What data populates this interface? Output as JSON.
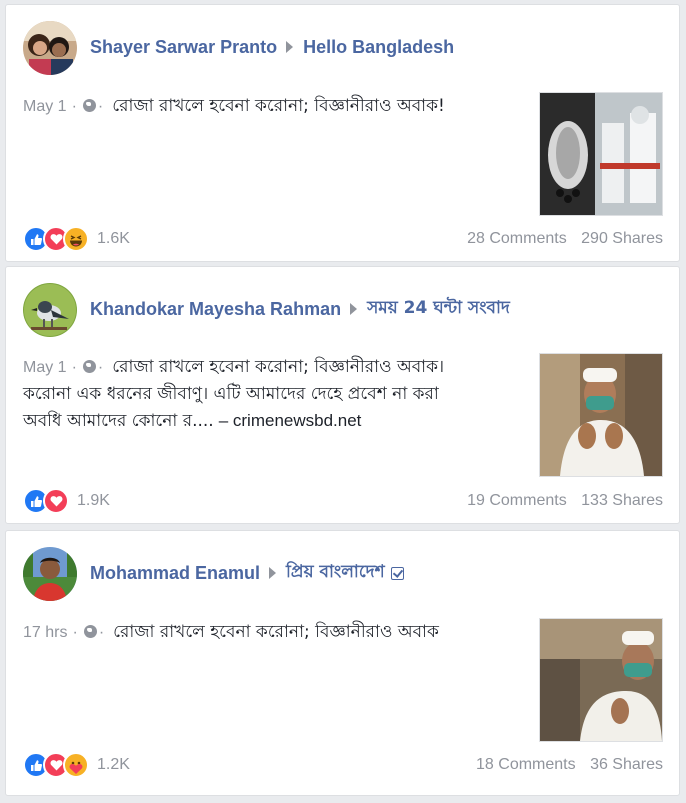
{
  "posts": [
    {
      "author": "Shayer Sarwar Pranto",
      "group": "Hello Bangladesh",
      "verified": false,
      "time": "May 1",
      "text_lines": [
        "রোজা রাখলে হবেনা করোনা; বিজ্ঞানীরাও অবাক!"
      ],
      "link_domain": "",
      "reaction_count": "1.6K",
      "comments": "28 Comments",
      "shares": "290 Shares",
      "reactions": [
        "like-icon",
        "love-icon",
        "haha-icon"
      ]
    },
    {
      "author": "Khandokar Mayesha Rahman",
      "group": "সময় 24 ঘন্টা সংবাদ",
      "verified": false,
      "time": "May 1",
      "text_lines": [
        "রোজা রাখলে হবেনা করোনা; বিজ্ঞানীরাও অবাক।",
        "করোনা এক ধরনের জীবাণু। এটি আমাদের দেহে প্রবেশ না করা",
        "অবধি আমাদের কোনো র...."
      ],
      "link_domain": "– crimenewsbd.net",
      "reaction_count": "1.9K",
      "comments": "19 Comments",
      "shares": "133 Shares",
      "reactions": [
        "like-icon",
        "love-icon"
      ]
    },
    {
      "author": "Mohammad Enamul",
      "group": "প্রিয় বাংলাদেশ",
      "verified": true,
      "time": "17 hrs",
      "text_lines": [
        "রোজা রাখলে হবেনা করোনা; বিজ্ঞানীরাও অবাক"
      ],
      "link_domain": "",
      "reaction_count": "1.2K",
      "comments": "18 Comments",
      "shares": "36 Shares",
      "reactions": [
        "like-icon",
        "love-icon",
        "care-icon"
      ]
    }
  ],
  "colors": {
    "link": "#4b67a1",
    "muted": "#90949c",
    "like": "#2078f4",
    "love": "#f33e58",
    "haha": "#f7b125"
  }
}
